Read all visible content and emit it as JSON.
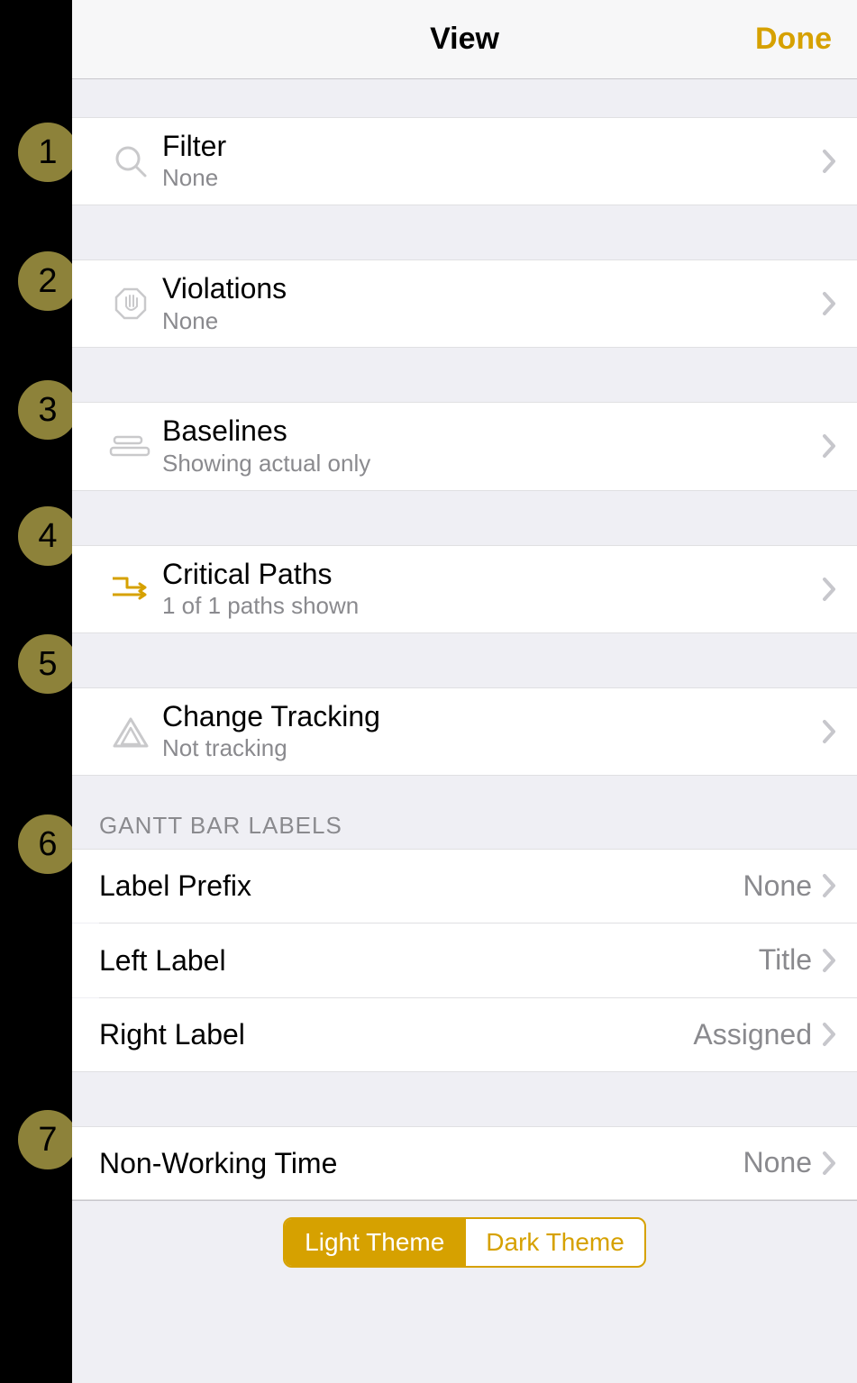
{
  "header": {
    "title": "View",
    "done": "Done"
  },
  "rows": {
    "filter": {
      "title": "Filter",
      "subtitle": "None"
    },
    "violations": {
      "title": "Violations",
      "subtitle": "None"
    },
    "baselines": {
      "title": "Baselines",
      "subtitle": "Showing actual only"
    },
    "critical": {
      "title": "Critical Paths",
      "subtitle": "1 of 1 paths shown"
    },
    "change": {
      "title": "Change Tracking",
      "subtitle": "Not tracking"
    }
  },
  "ganttSectionHeader": "GANTT BAR LABELS",
  "gantt": {
    "labelPrefix": {
      "title": "Label Prefix",
      "value": "None"
    },
    "leftLabel": {
      "title": "Left Label",
      "value": "Title"
    },
    "rightLabel": {
      "title": "Right Label",
      "value": "Assigned"
    }
  },
  "nonWorking": {
    "title": "Non-Working Time",
    "value": "None"
  },
  "theme": {
    "light": "Light Theme",
    "dark": "Dark Theme",
    "active": "light"
  },
  "callouts": [
    "1",
    "2",
    "3",
    "4",
    "5",
    "6",
    "7"
  ],
  "colors": {
    "accent": "#d6a100"
  }
}
